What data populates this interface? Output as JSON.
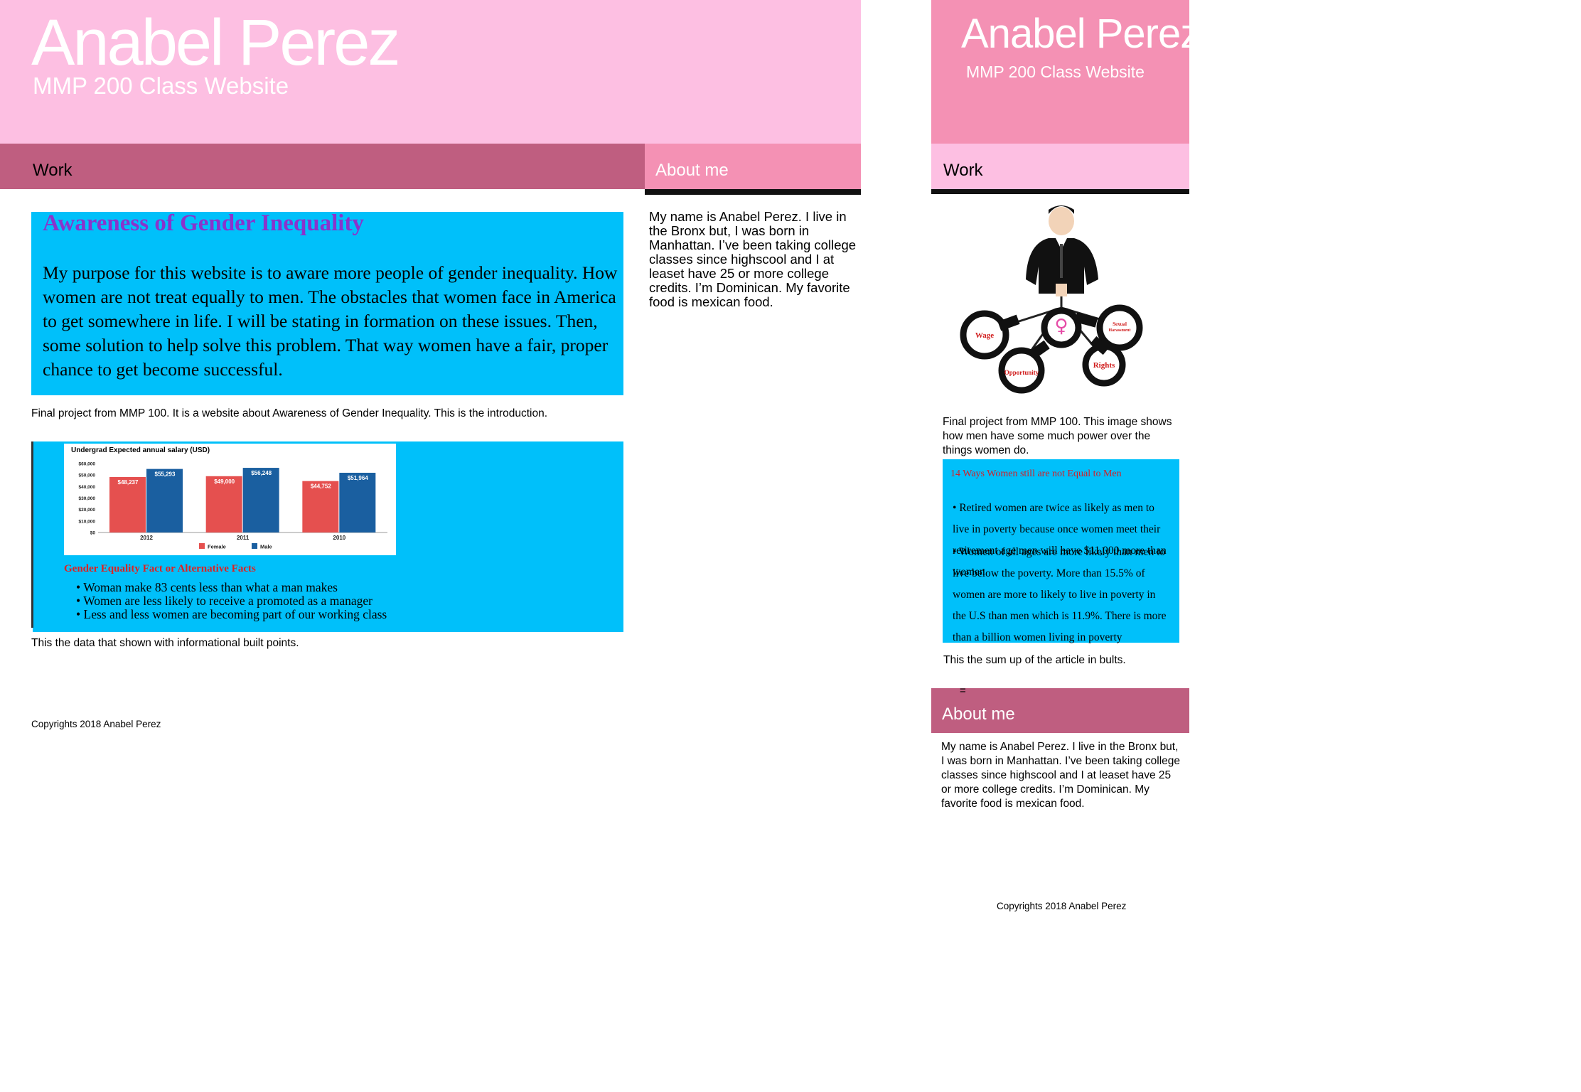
{
  "desktop": {
    "header": {
      "name": "Anabel Perez",
      "subtitle": "MMP 200 Class Website"
    },
    "nav": {
      "work": "Work",
      "about": "About me"
    },
    "about_text": "My name is Anabel Perez. I live in the Bronx but, I was born in Manhattan. I’ve been taking college classes since highscool and I at leaset have  25 or more college credits. I’m Dominican. My favorite food is mexican food.",
    "intro": {
      "title": "Awareness of Gender Inequality",
      "text": "My purpose for this website is to aware more people of gender inequality. How women are not treat equally to men. The obstacles that women face in America to get somewhere in life. I will be stating in formation on these issues. Then, some solution to help solve this problem. That way women have a fair, proper chance to get become successful.",
      "caption": "Final project from MMP 100. It is a website about Awareness of Gender Inequality. This is the introduction."
    },
    "facts": {
      "title": "Gender Equality Fact or Alternative Facts",
      "items": [
        "Woman make 83 cents less than what a man makes",
        "Women are less likely to receive a promoted as a manager",
        "Less and less women are becoming part of our working class"
      ],
      "caption": "This the data that shown with informational built points."
    },
    "copyright": "Copyrights 2018 Anabel Perez"
  },
  "chart_data": {
    "type": "bar",
    "title": "Undergrad Expected annual salary (USD)",
    "categories": [
      "2012",
      "2011",
      "2010"
    ],
    "series": [
      {
        "name": "Female",
        "values": [
          48237,
          49000,
          44752
        ],
        "labels": [
          "$48,237",
          "$49,000",
          "$44,752"
        ],
        "color": "#e5504f"
      },
      {
        "name": "Male",
        "values": [
          55293,
          56248,
          51964
        ],
        "labels": [
          "$55,293",
          "$56,248",
          "$51,964"
        ],
        "color": "#1a5fa0"
      }
    ],
    "yticks": [
      "$0",
      "$10,000",
      "$20,000",
      "$30,000",
      "$40,000",
      "$50,000",
      "$60,000"
    ],
    "ylim": [
      0,
      60000
    ],
    "legend": "bottom"
  },
  "mobile": {
    "header": {
      "name": "Anabel Perez",
      "subtitle": "MMP 200 Class Website"
    },
    "nav": {
      "work": "Work",
      "about": "About me"
    },
    "image_labels": {
      "wage": "Wage",
      "harassment1": "Sexual",
      "harassment2": "Harassment",
      "rights": "Rights",
      "opportunity": "Opportunity"
    },
    "image_caption": "Final project from MMP 100.  This image shows how men have some much power over the things women do.",
    "article": {
      "title": "14 Ways Women still are not Equal to Men",
      "bullets": [
        "Retired women are twice as likely as men to live in poverty because once women meet their retirement age men will have $11,000 more than women",
        "Women of all ages are more likely than men to live below the poverty. More than 15.5% of women are more to likely to live in poverty in the U.S than men which is 11.9%. There is more than a billion women living in poverty"
      ],
      "caption": "This the sum up of the article in bults."
    },
    "stray_mark": "=",
    "about_text": "My name is Anabel Perez. I live in the Bronx but, I was born in Manhattan. I’ve been taking college classes since highscool and I at leaset have  25 or more college credits. I’m Dominican. My favorite food is mexican food.",
    "copyright": "Copyrights 2018 Anabel Perez"
  },
  "colors": {
    "light_pink": "#fdbfe2",
    "mid_pink": "#f491b4",
    "rose": "#bf5e80",
    "cyan": "#00c0fa"
  }
}
